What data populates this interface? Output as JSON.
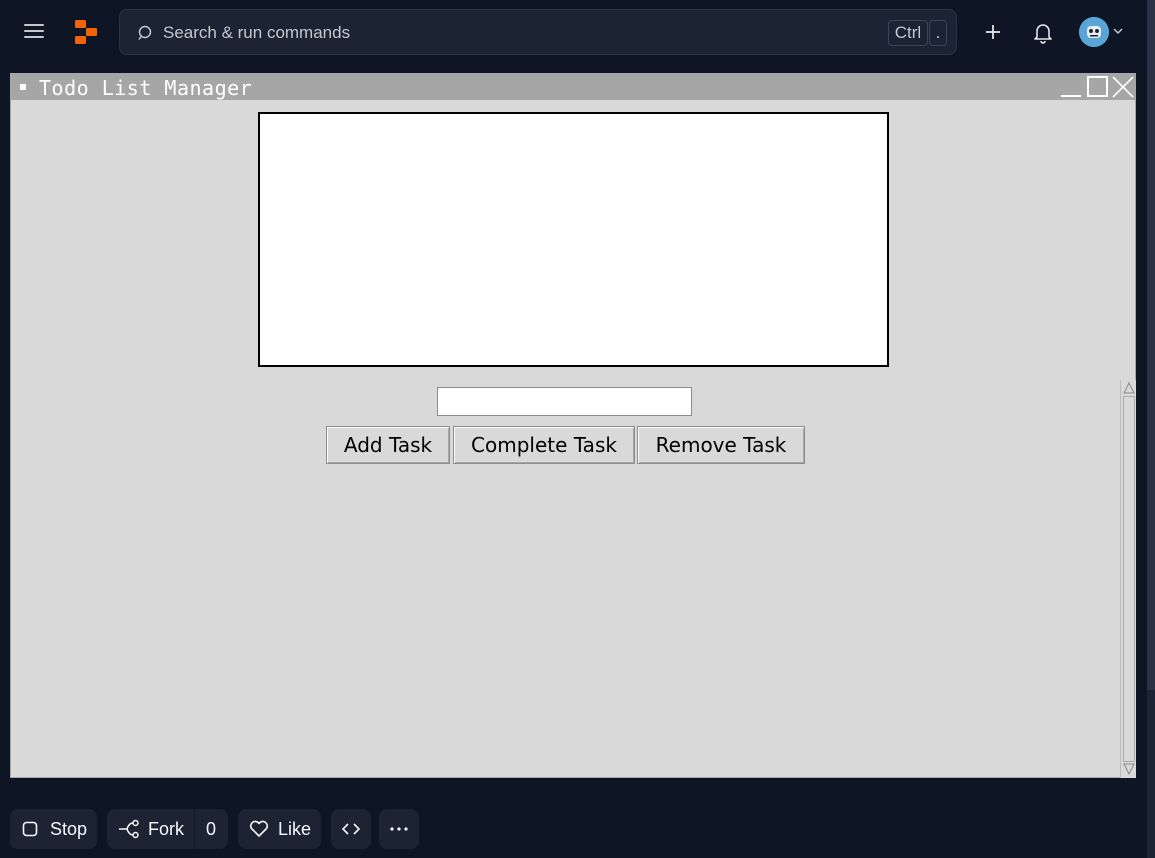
{
  "topbar": {
    "search_placeholder": "Search & run commands",
    "shortcut_key1": "Ctrl",
    "shortcut_key2": ".",
    "accent_color": "#f26207"
  },
  "window": {
    "title": "Todo List Manager",
    "entry_value": "",
    "buttons": {
      "add": "Add Task",
      "complete": "Complete Task",
      "remove": "Remove Task"
    }
  },
  "bottombar": {
    "stop_label": "Stop",
    "fork_label": "Fork",
    "fork_count": "0",
    "like_label": "Like",
    "code_label": "<>",
    "more_label": "···"
  }
}
